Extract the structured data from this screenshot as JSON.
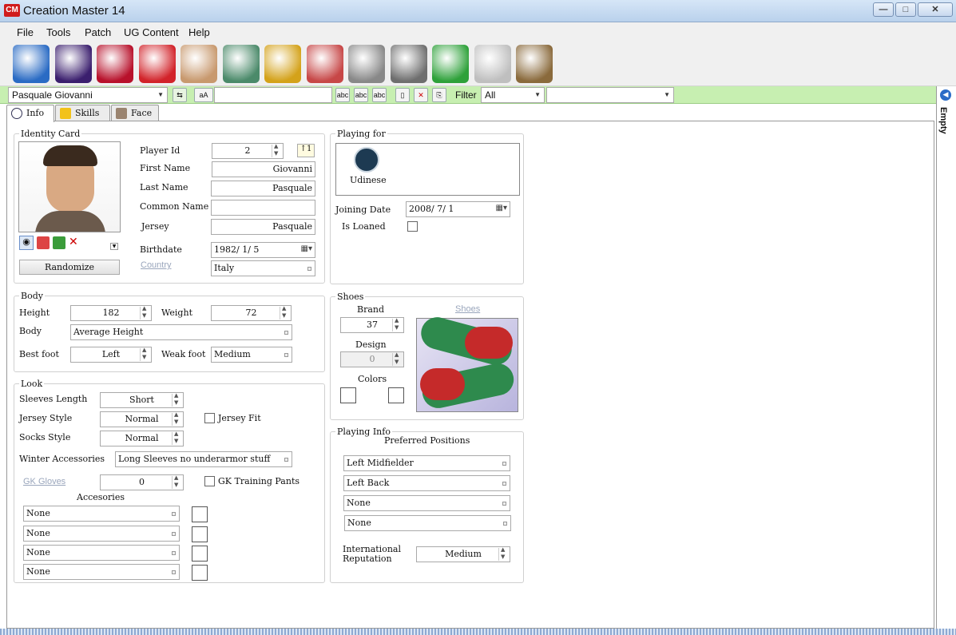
{
  "window": {
    "title": "Creation Master 14",
    "icon_text": "CM",
    "minimize": "—",
    "maximize": "□",
    "close": "✕"
  },
  "menu": [
    "File",
    "Tools",
    "Patch",
    "UG Content",
    "Help"
  ],
  "toolbar": {
    "icons": [
      "globe-icon",
      "premier-league-icon",
      "fcb-club-icon",
      "jersey-icon",
      "player-face-icon",
      "stadium-icon",
      "trophy-icon",
      "cards-icon",
      "ball-icon",
      "boots-icon",
      "pitch-icon",
      "newspaper-icon",
      "gloves-icon"
    ],
    "colors": [
      "#2a6bc4",
      "#3b1f6e",
      "#b8112b",
      "#d2232a",
      "#c8996e",
      "#4b8a6a",
      "#d4a21a",
      "#c74747",
      "#888888",
      "#6e6e6e",
      "#2ea13a",
      "#bfbfbf",
      "#8a6a3c"
    ]
  },
  "filterbar": {
    "player_select": "Pasquale Giovanni",
    "text_btn": "aA",
    "abc_btns": [
      "abc",
      "abc",
      "abc"
    ],
    "filter_label": "Filter",
    "filter_value": "All",
    "second_select": ""
  },
  "tabs": [
    {
      "label": "Info"
    },
    {
      "label": "Skills"
    },
    {
      "label": "Face"
    }
  ],
  "identity": {
    "title": "Identity Card",
    "player_id_label": "Player Id",
    "player_id": "2",
    "first_name_label": "First Name",
    "first_name": "Giovanni",
    "last_name_label": "Last Name",
    "last_name": "Pasquale",
    "common_name_label": "Common Name",
    "common_name": "",
    "jersey_label": "Jersey",
    "jersey": "Pasquale",
    "birthdate_label": "Birthdate",
    "birthdate": "1982/ 1/ 5",
    "country_label": "Country",
    "country": "Italy",
    "randomize": "Randomize"
  },
  "playing_for": {
    "title": "Playing for",
    "club": "Udinese",
    "joining_label": "Joining Date",
    "joining_date": "2008/ 7/ 1",
    "loaned_label": "Is Loaned"
  },
  "body": {
    "title": "Body",
    "height_label": "Height",
    "height": "182",
    "weight_label": "Weight",
    "weight": "72",
    "body_label": "Body",
    "body": "Average Height",
    "best_foot_label": "Best foot",
    "best_foot": "Left",
    "weak_foot_label": "Weak foot",
    "weak_foot": "Medium"
  },
  "shoes": {
    "title": "Shoes",
    "brand_label": "Brand",
    "brand": "37",
    "design_label": "Design",
    "design": "0",
    "colors_label": "Colors",
    "link": "Shoes"
  },
  "look": {
    "title": "Look",
    "sleeves_label": "Sleeves Length",
    "sleeves": "Short",
    "jersey_style_label": "Jersey Style",
    "jersey_style": "Normal",
    "jersey_fit_label": "Jersey Fit",
    "socks_label": "Socks Style",
    "socks": "Normal",
    "winter_label": "Winter Accessories",
    "winter": "Long Sleeves no underarmor stuff",
    "gloves_label": "GK Gloves",
    "gloves": "0",
    "training_pants_label": "GK Training Pants",
    "accessories_label": "Accesories",
    "accessories": [
      "None",
      "None",
      "None",
      "None"
    ]
  },
  "playing_info": {
    "title": "Playing Info",
    "positions_label": "Preferred Positions",
    "positions": [
      "Left Midfielder",
      "Left Back",
      "None",
      "None"
    ],
    "intl_rep_label_1": "International",
    "intl_rep_label_2": "Reputation",
    "intl_rep": "Medium"
  },
  "side_panel": {
    "label": "Empty"
  }
}
